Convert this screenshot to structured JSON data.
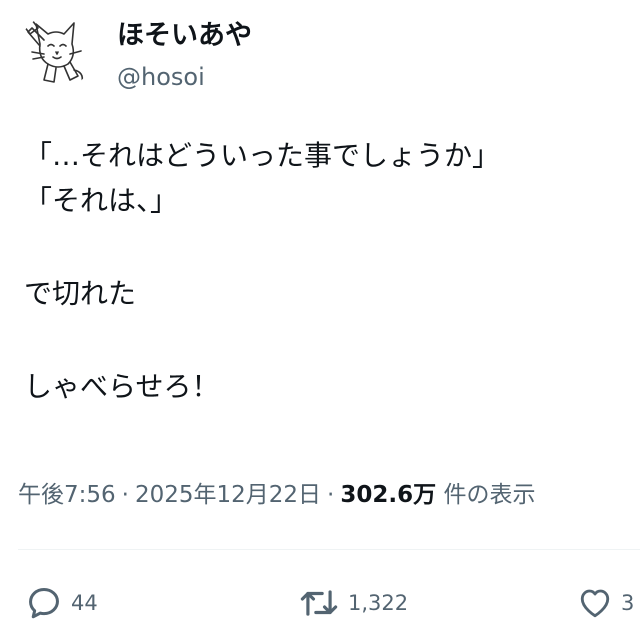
{
  "author": {
    "display_name": "ほそいあや",
    "handle": "@hosoi"
  },
  "tweet": {
    "lines": [
      "「…それはどういった事でしょうか」",
      "「それは、」",
      "",
      "で切れた",
      "",
      "しゃべらせろ！"
    ]
  },
  "meta": {
    "time": "午後7:56",
    "separator": "·",
    "date": "2025年12月22日",
    "views_count": "302.6万",
    "views_label": "件の表示"
  },
  "actions": {
    "replies": "44",
    "retweets": "1,322",
    "likes": "3"
  },
  "icons": {
    "reply": "reply-icon",
    "retweet": "retweet-icon",
    "like": "heart-icon"
  },
  "colors": {
    "text": "#0f1419",
    "secondary": "#536471",
    "divider": "#eff3f4"
  }
}
